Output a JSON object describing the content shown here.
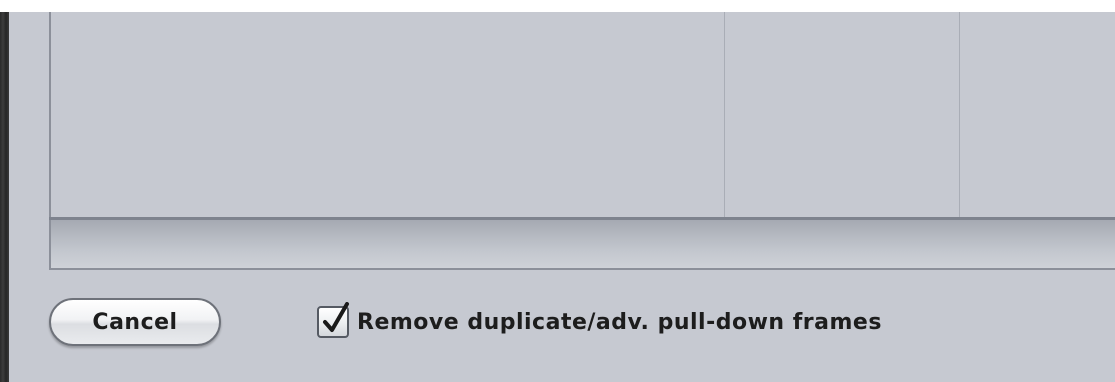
{
  "dialog": {
    "cancel_label": "Cancel",
    "checkbox": {
      "label": "Remove duplicate/adv. pull-down frames",
      "checked": true
    }
  },
  "icons": {
    "checkmark": "checkmark-icon"
  },
  "colors": {
    "panel_background": "#c6c9d1",
    "window_edge": "#2a2a2a",
    "divider": "#a9adb6"
  }
}
